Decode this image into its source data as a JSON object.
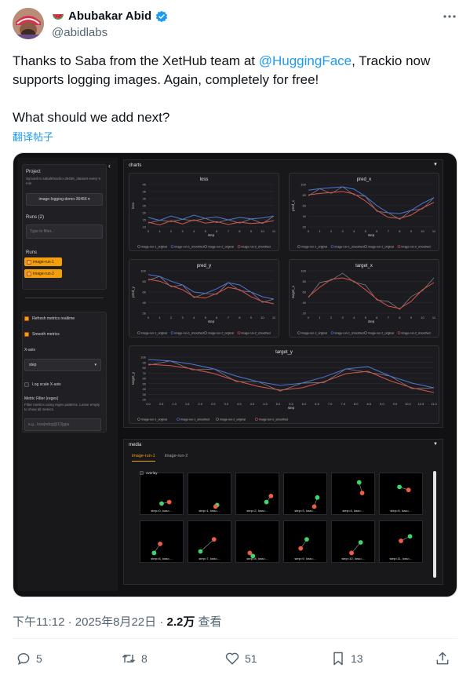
{
  "author": {
    "name": "Abubakar Abid",
    "handle": "@abidlabs"
  },
  "tweet": {
    "line1_pre": "Thanks to Saba from the XetHub team at ",
    "mention": "@HuggingFace",
    "line1_post": ", Trackio now supports logging images. Again, completely for free!",
    "line2": "What should we add next?",
    "translate": "翻译帖子"
  },
  "screenshot": {
    "sidebar": {
      "project_label": "Project",
      "synced_text": "Synced to sabalt/trackio-36456_dataset every 5 min",
      "project_value": "image-logging-demo-36456 ▾",
      "runs_count_label": "Runs (2)",
      "filter_placeholder": "Type to filter...",
      "runs_label": "Runs",
      "runs": [
        "image-run-1",
        "image-run-2"
      ],
      "refresh_label": "Refresh metrics realtime",
      "smooth_label": "Smooth metrics",
      "xaxis_label": "X-axis",
      "xaxis_value": "step",
      "logscale_label": "Log scale X-axis",
      "metric_filter_label": "Metric Filter (regex)",
      "metric_filter_help": "Filter metrics using regex patterns. Leave empty to show all metrics.",
      "metric_filter_placeholder": "e.g., loss|ndcg@10|gpu"
    },
    "charts_panel": {
      "title": "charts",
      "caret": "▼",
      "xlabel": "step",
      "legend": [
        "image-run-1_original",
        "image-run-1_smoothed",
        "image-run-2_original",
        "image-run-2_smoothed"
      ],
      "charts": [
        {
          "title": "loss",
          "ylabel": "loss",
          "yticks": [
            "40",
            "35",
            "30",
            "25",
            "20",
            "15",
            "10"
          ],
          "xticks": [
            "0",
            "1",
            "2",
            "3",
            "4",
            "5",
            "6",
            "7",
            "8",
            "9",
            "10",
            "11"
          ]
        },
        {
          "title": "pred_x",
          "ylabel": "pred_x",
          "yticks": [
            "100",
            "80",
            "60",
            "40",
            "20"
          ],
          "xticks": [
            "0",
            "1",
            "2",
            "3",
            "4",
            "5",
            "6",
            "7",
            "8",
            "9",
            "10",
            "11"
          ]
        },
        {
          "title": "pred_y",
          "ylabel": "pred_y",
          "yticks": [
            "100",
            "80",
            "60",
            "40",
            "20"
          ],
          "xticks": [
            "0",
            "1",
            "2",
            "3",
            "4",
            "5",
            "6",
            "7",
            "8",
            "9",
            "10",
            "11"
          ]
        },
        {
          "title": "target_x",
          "ylabel": "target_x",
          "yticks": [
            "100",
            "80",
            "60",
            "40",
            "20"
          ],
          "xticks": [
            "0",
            "1",
            "2",
            "3",
            "4",
            "5",
            "6",
            "7",
            "8",
            "9",
            "10",
            "11"
          ]
        },
        {
          "title": "target_y",
          "ylabel": "target_y",
          "yticks": [
            "100",
            "90",
            "80",
            "70",
            "60",
            "50",
            "40",
            "30",
            "20"
          ],
          "xticks": [
            "0.0",
            "0.5",
            "1.0",
            "1.5",
            "2.0",
            "2.5",
            "3.0",
            "3.5",
            "4.0",
            "4.5",
            "5.0",
            "5.5",
            "6.0",
            "6.5",
            "7.0",
            "7.5",
            "8.0",
            "8.5",
            "9.0",
            "9.5",
            "10.0",
            "10.5",
            "11.0"
          ]
        }
      ]
    },
    "media_panel": {
      "title": "media",
      "caret": "▼",
      "tabs": [
        "image-run-1",
        "image-run-2"
      ],
      "overlay_label": "overlay",
      "thumbs": [
        "step=0, loss=...",
        "step=1, loss=...",
        "step=2, loss=...",
        "step=3, loss=...",
        "step=4, loss=...",
        "step=5, loss=...",
        "step=6, loss=...",
        "step=7, loss=...",
        "step=8, loss=...",
        "step=9, loss=...",
        "step=10, loss=...",
        "step=11, loss=..."
      ]
    }
  },
  "meta": {
    "time": "下午11:12 · 2025年8月22日 · ",
    "views": "2.2万",
    "views_label": " 查看"
  },
  "actions": {
    "replies": "5",
    "retweets": "8",
    "likes": "51",
    "bookmarks": "13"
  },
  "colors": {
    "accent": "#1d9bf0",
    "run_orange": "#f59e0b",
    "series_blue": "#4f74d8",
    "series_red": "#d9534f",
    "series_gray": "#8a8a8a"
  }
}
